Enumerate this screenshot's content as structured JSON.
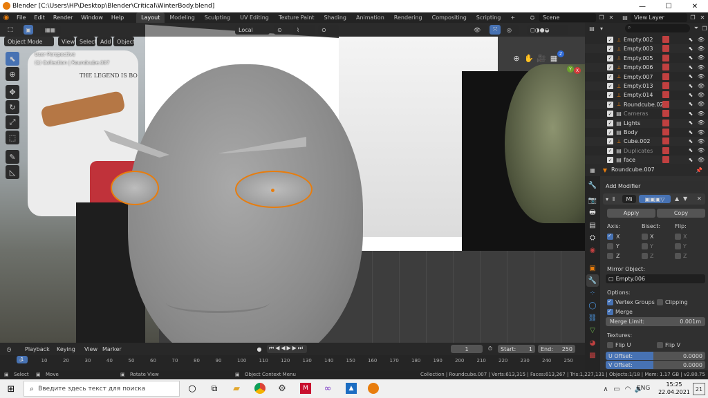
{
  "title_bar": {
    "title": "Blender [C:\\Users\\HP\\Desktop\\Blender\\Critical\\WinterBody.blend]",
    "min": "—",
    "max": "☐",
    "close": "✕"
  },
  "menu": [
    "File",
    "Edit",
    "Render",
    "Window",
    "Help"
  ],
  "workspace_tabs": [
    "Layout",
    "Modeling",
    "Sculpting",
    "UV Editing",
    "Texture Paint",
    "Shading",
    "Animation",
    "Rendering",
    "Compositing",
    "Scripting",
    "+"
  ],
  "scene": {
    "label": "Scene",
    "view_layer": "View Layer"
  },
  "viewport": {
    "mode": "Object Mode",
    "menus": [
      "View",
      "Select",
      "Add",
      "Object"
    ],
    "orientation": "Local",
    "perspective": "User Perspective",
    "collection_line": "(1) Collection | Roundcube.007",
    "shirt_text": "THE LEGEND IS BO",
    "gizmo": {
      "z": "Z",
      "y": "Y",
      "x": "X"
    }
  },
  "outliner": {
    "search_placeholder": "",
    "rows": [
      {
        "name": "Empty.002",
        "dim": false
      },
      {
        "name": "Empty.003",
        "dim": false
      },
      {
        "name": "Empty.005",
        "dim": false
      },
      {
        "name": "Empty.006",
        "dim": false
      },
      {
        "name": "Empty.007",
        "dim": false
      },
      {
        "name": "Empty.013",
        "dim": false
      },
      {
        "name": "Empty.014",
        "dim": false
      },
      {
        "name": "Roundcube.023",
        "dim": false
      },
      {
        "name": "Cameras",
        "dim": true
      },
      {
        "name": "Lights",
        "dim": false
      },
      {
        "name": "Body",
        "dim": false
      },
      {
        "name": "Cube.002",
        "dim": false
      },
      {
        "name": "Duplicates",
        "dim": true
      },
      {
        "name": "face",
        "dim": false
      }
    ]
  },
  "properties": {
    "object_name": "Roundcube.007",
    "add_modifier": "Add Modifier",
    "modifier_short": "Mi",
    "apply": "Apply",
    "copy": "Copy",
    "axis_label": "Axis:",
    "bisect_label": "Bisect:",
    "flip_label": "Flip:",
    "axes": [
      "X",
      "Y",
      "Z"
    ],
    "mirror_object_label": "Mirror Object:",
    "mirror_object": "Empty.006",
    "options_label": "Options:",
    "vertex_groups": "Vertex Groups",
    "clipping": "Clipping",
    "merge": "Merge",
    "merge_limit_label": "Merge Limit:",
    "merge_limit": "0.001m",
    "textures_label": "Textures:",
    "flip_u": "Flip U",
    "flip_v": "Flip V",
    "u_offset_label": "U Offset:",
    "u_offset": "0.0000",
    "v_offset_label": "V Offset:",
    "v_offset": "0.0000"
  },
  "timeline": {
    "menus": [
      "Playback",
      "Keying",
      "View",
      "Marker"
    ],
    "current_frame": "1",
    "start_label": "Start:",
    "start": "1",
    "end_label": "End:",
    "end": "250",
    "ticks": [
      "0",
      "10",
      "20",
      "30",
      "40",
      "50",
      "60",
      "70",
      "80",
      "90",
      "100",
      "110",
      "120",
      "130",
      "140",
      "150",
      "160",
      "170",
      "180",
      "190",
      "200",
      "210",
      "220",
      "230",
      "240",
      "250"
    ],
    "playhead": "1"
  },
  "status_bar": {
    "select": "Select",
    "move": "Move",
    "rotate": "Rotate View",
    "context": "Object Context Menu",
    "stats": "Collection | Roundcube.007 | Verts:613,315 | Faces:613,267 | Tris:1,227,131 | Objects:1/18 | Mem: 1.17 GB | v2.80.75"
  },
  "taskbar": {
    "search_placeholder": "Введите здесь текст для поиска",
    "lang": "ENG",
    "time": "15:25",
    "date": "22.04.2021",
    "notif": "21"
  },
  "colors": {
    "accent": "#4772b3",
    "orange": "#e87d0d",
    "bg": "#3d3d3d"
  }
}
